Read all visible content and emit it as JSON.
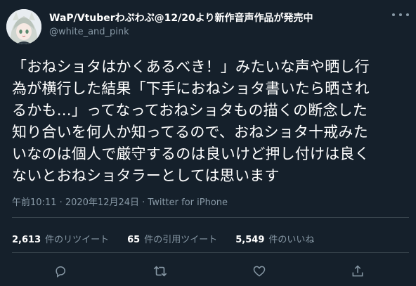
{
  "author": {
    "display_name": "WaP/Vtuberわぷわぷ@12/20より新作音声作品が発売中",
    "handle": "@white_and_pink"
  },
  "tweet": {
    "lines": [
      "「おねショタはかくあるべき！」みたいな声や晒し行",
      "為が横行した結果「下手におねショタ書いたら晒され",
      "るかも…」ってなっておねショタもの描くの断念した",
      "知り合いを何人か知ってるので、おねショタ十戒みた",
      "いなのは個人で厳守するのは良いけど押し付けは良く",
      "ないとおねショタラーとしては思います"
    ],
    "meta": "午前10:11 · 2020年12月24日 · Twitter for iPhone"
  },
  "stats": {
    "retweets_count": "2,613",
    "retweets_label": "件のリツイート",
    "quotes_count": "65",
    "quotes_label": "件の引用ツイート",
    "likes_count": "5,549",
    "likes_label": "件のいいね"
  },
  "icons": {
    "reply": "reply-icon",
    "retweet": "retweet-icon",
    "like": "heart-icon",
    "share": "share-icon",
    "more": "more-icon"
  },
  "colors": {
    "background": "#15202b",
    "text": "#ffffff",
    "secondary": "#8899a6",
    "divider": "#38444d"
  }
}
